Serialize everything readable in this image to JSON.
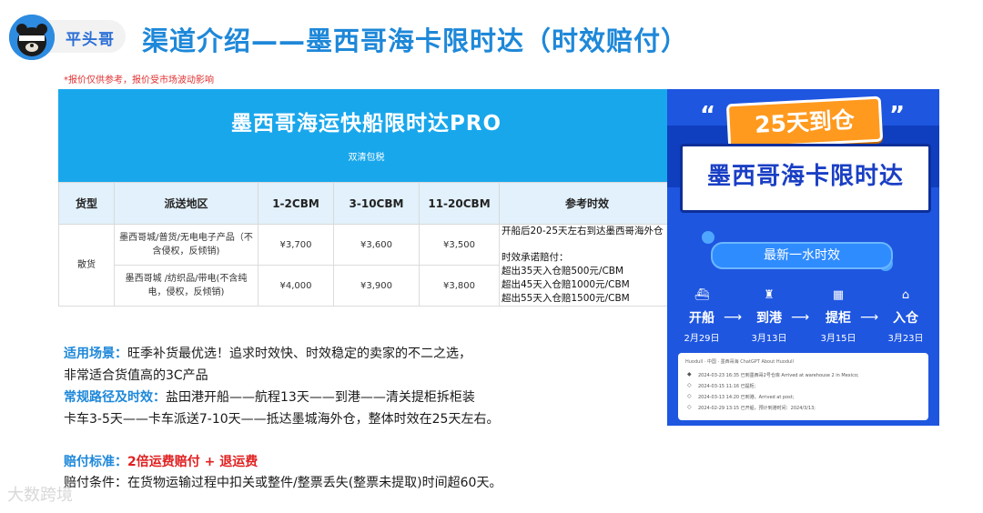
{
  "brand": {
    "name": "平头哥"
  },
  "page_title": "渠道介绍——墨西哥海卡限时达（时效赔付）",
  "disclaimer": "*报价仅供参考，报价受市场波动影响",
  "table": {
    "title": "墨西哥海运快船限时达PRO",
    "subtitle": "双清包税",
    "headers": [
      "货型",
      "派送地区",
      "1-2CBM",
      "3-10CBM",
      "11-20CBM",
      "参考时效"
    ],
    "cargo_type": "散货",
    "rows": [
      {
        "area": "墨西哥城/普货/无电电子产品（不含侵权，反倾销)",
        "p1": "¥3,700",
        "p2": "¥3,600",
        "p3": "¥3,500"
      },
      {
        "area": "墨西哥城 /纺织品/带电(不含纯电，侵权，反倾销)",
        "p1": "¥4,000",
        "p2": "¥3,900",
        "p3": "¥3,800"
      }
    ],
    "reference": {
      "line1": "开船后20-25天左右到达墨西哥海外仓",
      "line2": "时效承诺赔付：",
      "line3": "超出35天入仓赔500元/CBM",
      "line4": "超出45天入仓赔1000元/CBM",
      "line5": "超出55天入仓赔1500元/CBM"
    }
  },
  "poster": {
    "badge": "25天到仓",
    "headline": "墨西哥海卡限时达",
    "pill": "最新一水时效",
    "steps": [
      {
        "label": "开船",
        "date": "2月29日"
      },
      {
        "label": "到港",
        "date": "3月13日"
      },
      {
        "label": "提柜",
        "date": "3月15日"
      },
      {
        "label": "入仓",
        "date": "3月23日"
      }
    ],
    "tracking": {
      "header": "Huodull · 中国 · 墨西哥海    ChatGPT About Huodull",
      "events": [
        "2024-03-23 16:35   已到墨西哥2号仓库 Arrived at warehouse 2 in Mexico;",
        "2024-03-15 11:16   已提柜;",
        "2024-03-13 14:20   已到港。Arrived at post;",
        "2024-02-29 13:15   已开船，预计到港时间：2024/3/13;"
      ]
    },
    "colors": {
      "bg": "#1e56e0",
      "badge": "#ff9a1f",
      "headline": "#1a3fc4"
    }
  },
  "info": {
    "scene_label": "适用场景：",
    "scene_text": "旺季补货最优选！追求时效快、时效稳定的卖家的不二之选，",
    "scene_text2": "非常适合货值高的3C产品",
    "route_label": "常规路径及时效：",
    "route_text": "盐田港开船——航程13天——到港——清关提柜拆柜装",
    "route_text2": "卡车3-5天——卡车派送7-10天——抵达墨城海外仓，整体时效在25天左右。",
    "comp_label": "赔付标准：",
    "comp_text": "2倍运费赔付 + 退运费",
    "cond_text": "赔付条件：在货物运输过程中扣关或整件/整票丢失(整票未提取)时间超60天。"
  },
  "watermark": "大数跨境"
}
